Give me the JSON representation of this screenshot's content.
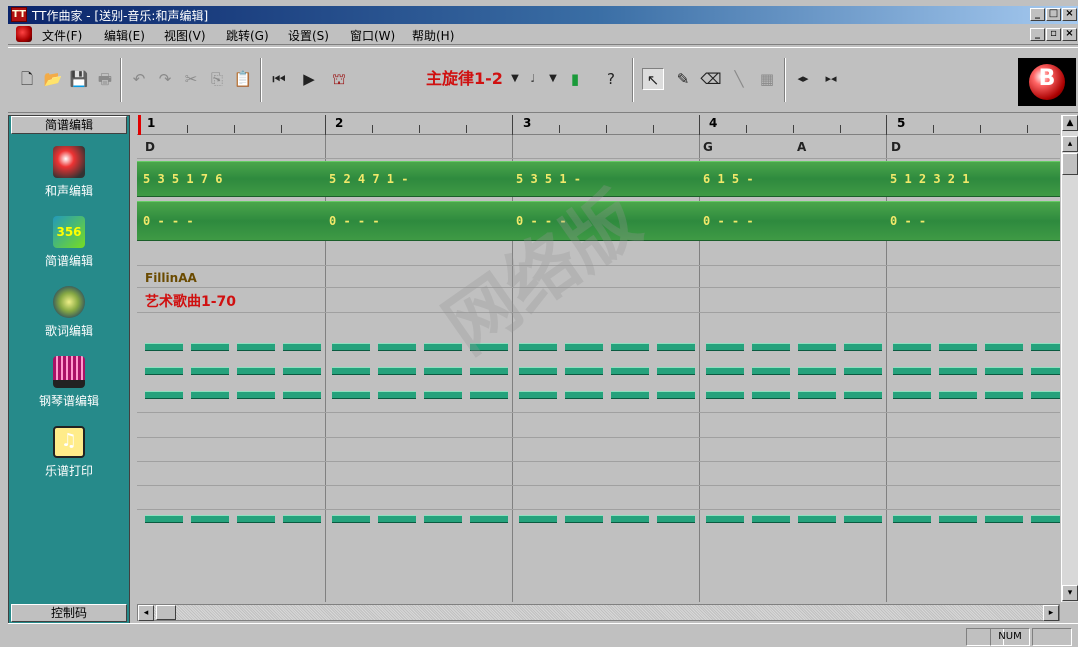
{
  "window": {
    "title": "TT作曲家 - [送别-音乐:和声编辑]",
    "app_icon_letter": "TT"
  },
  "menu": {
    "items": [
      "文件(F)",
      "编辑(E)",
      "视图(V)",
      "跳转(G)",
      "设置(S)",
      "窗口(W)",
      "帮助(H)"
    ]
  },
  "toolbar": {
    "track_label": "主旋律1-2",
    "logo_text": "B"
  },
  "left_panel": {
    "header": "简谱编辑",
    "items": [
      {
        "label": "和声编辑",
        "icon": "harmony-icon"
      },
      {
        "label": "简谱编辑",
        "icon": "numbered-notation-icon"
      },
      {
        "label": "歌词编辑",
        "icon": "lyrics-icon"
      },
      {
        "label": "钢琴谱编辑",
        "icon": "piano-score-icon"
      },
      {
        "label": "乐谱打印",
        "icon": "score-print-icon"
      }
    ],
    "footer": "控制码"
  },
  "ruler": {
    "measures": [
      "1",
      "2",
      "3",
      "4",
      "5"
    ]
  },
  "chords": [
    {
      "text": "D"
    },
    {
      "text": "G"
    },
    {
      "text": "A"
    },
    {
      "text": "D"
    }
  ],
  "melody": {
    "segments": [
      "5   3 5 1   7 6",
      "5 2 4 7 1   -",
      "5   3 5 1   -",
      "6   1   5   -",
      "5   1 2 3   2 1"
    ]
  },
  "bass": {
    "segments": [
      "0   -   -   -",
      "0   -   -   -",
      "0   -   -   -",
      "0   -   -   -",
      "0   -   -"
    ]
  },
  "track_meta": {
    "fillin": "FillinAA",
    "song_title": "艺术歌曲1-70"
  },
  "status": {
    "num": "NUM"
  },
  "watermark": "网络版"
}
